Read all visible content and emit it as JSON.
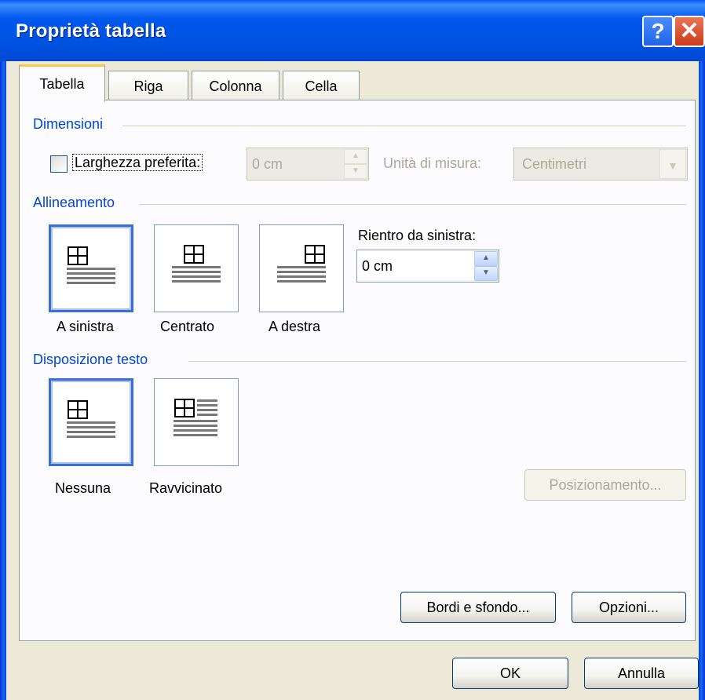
{
  "window": {
    "title": "Proprietà tabella",
    "help_glyph": "?",
    "close_glyph": "✕"
  },
  "tabs": [
    {
      "label": "Tabella",
      "active": true
    },
    {
      "label": "Riga"
    },
    {
      "label": "Colonna"
    },
    {
      "label": "Cella"
    }
  ],
  "dimensioni": {
    "group_label": "Dimensioni",
    "preferred_width_label": "Larghezza preferita:",
    "preferred_width_checked": false,
    "preferred_width_value": "0 cm",
    "unit_label": "Unità di misura:",
    "unit_value": "Centimetri"
  },
  "allineamento": {
    "group_label": "Allineamento",
    "options": [
      {
        "label": "A sinistra",
        "selected": true
      },
      {
        "label": "Centrato"
      },
      {
        "label": "A destra"
      }
    ],
    "indent_label": "Rientro da sinistra:",
    "indent_value": "0 cm"
  },
  "disposizione": {
    "group_label": "Disposizione testo",
    "options": [
      {
        "label": "Nessuna",
        "selected": true
      },
      {
        "label": "Ravvicinato"
      }
    ],
    "positioning_button": "Posizionamento..."
  },
  "buttons": {
    "borders": "Bordi e sfondo...",
    "options": "Opzioni...",
    "ok": "OK",
    "cancel": "Annulla"
  },
  "colors": {
    "accent": "#0046d5",
    "title_bar": "#0058ee",
    "tab_highlight": "#ffc83c",
    "selection": "#3c6ed4"
  }
}
